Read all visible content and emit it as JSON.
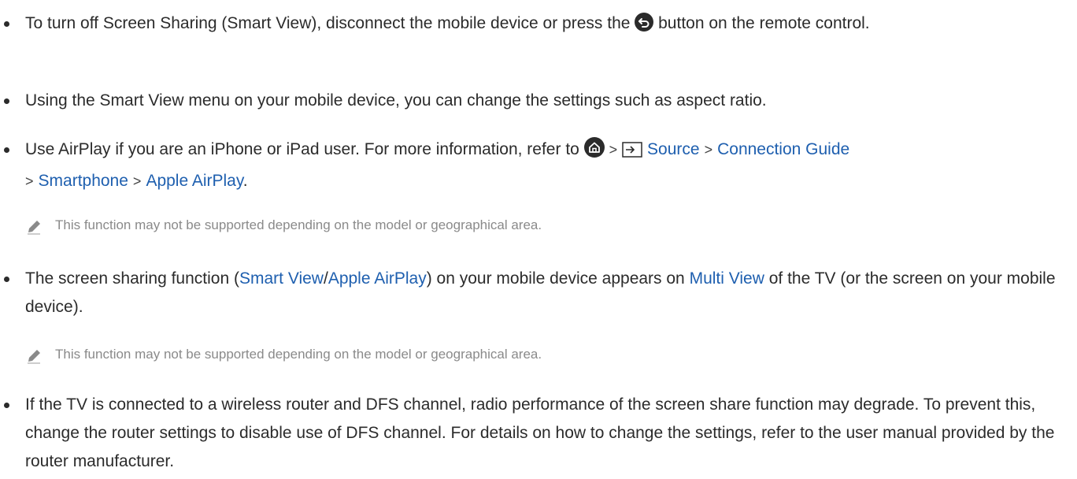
{
  "items": [
    {
      "before": "To turn off Screen Sharing (Smart View), disconnect the mobile device or press the",
      "after": " button on the remote control.",
      "icon": "return-icon"
    },
    {
      "text": "Using the Smart View menu on your mobile device, you can change the settings such as aspect ratio."
    },
    {
      "before": "Use AirPlay if you are an iPhone or iPad user. For more information, refer to",
      "icon": "home-icon",
      "sep": ">",
      "source_icon": "source-icon",
      "path": [
        "Source",
        "Connection Guide",
        "Smartphone",
        "Apple AirPlay"
      ],
      "end": "."
    },
    {
      "t1": "The screen sharing function (",
      "link1": "Smart View",
      "slash": "/",
      "link2": "Apple AirPlay",
      "t2": ") on your mobile device appears on ",
      "link3": "Multi View",
      "t3": " of the TV (or the screen on your mobile device)."
    },
    {
      "text": "If the TV is connected to a wireless router and DFS channel, radio performance of the screen share function may degrade. To prevent this, change the router settings to disable use of DFS channel. For details on how to change the settings, refer to the user manual provided by the router manufacturer."
    }
  ],
  "notes": [
    {
      "icon": "pencil-icon",
      "text": "This function may not be supported depending on the model or geographical area."
    },
    {
      "icon": "pencil-icon",
      "text": "This function may not be supported depending on the model or geographical area."
    }
  ],
  "colors": {
    "text": "#2b2b2b",
    "link": "#1e5faf",
    "note": "#8a8a8a"
  }
}
